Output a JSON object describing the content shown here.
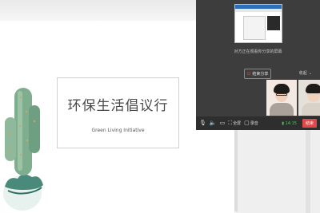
{
  "slide": {
    "title": "环保生活倡议行",
    "subtitle": "Green  Living  Initiative"
  },
  "meeting": {
    "share_caption": "对方正在观看你分享的屏幕",
    "stop_share_label": "结束分享",
    "collapse_label": "收起",
    "toolbar": {
      "fullscreen_label": "全屏",
      "record_label": "录音",
      "signal_value": "14:15",
      "end_label": "结束"
    }
  },
  "colors": {
    "panel_bg": "#3d3d3d",
    "end_button": "#e14848",
    "signal": "#4fc45f"
  }
}
